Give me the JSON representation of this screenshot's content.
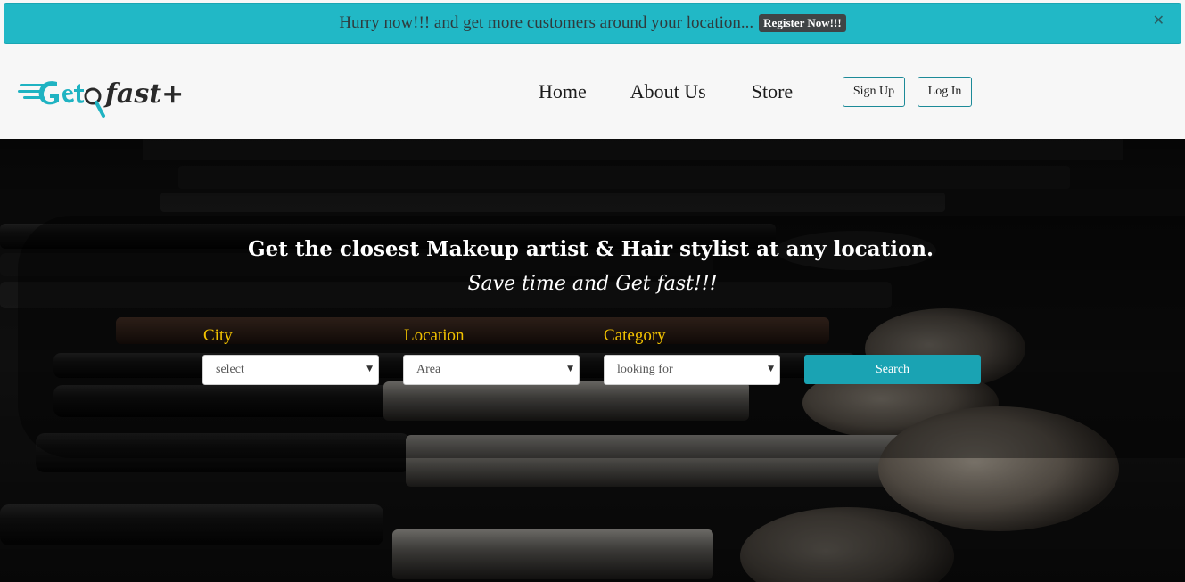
{
  "promo": {
    "text": "Hurry now!!! and get more customers around your location...",
    "register_label": "Register Now!!!",
    "close_icon": "close-icon"
  },
  "header": {
    "logo_alt": "GetQfast+",
    "nav": [
      {
        "label": "Home"
      },
      {
        "label": "About Us"
      },
      {
        "label": "Store"
      }
    ],
    "signup_label": "Sign Up",
    "login_label": "Log In"
  },
  "hero": {
    "title": "Get the closest Makeup artist & Hair stylist at any location.",
    "subtitle": "Save time and Get fast!!!",
    "fields": {
      "city_label": "City",
      "city_value": "select",
      "location_label": "Location",
      "location_value": "Area",
      "category_label": "Category",
      "category_value": "looking for"
    },
    "search_label": "Search"
  },
  "colors": {
    "banner": "#21b8c6",
    "accent": "#1aa3b3",
    "label_gold": "#f2c200"
  }
}
